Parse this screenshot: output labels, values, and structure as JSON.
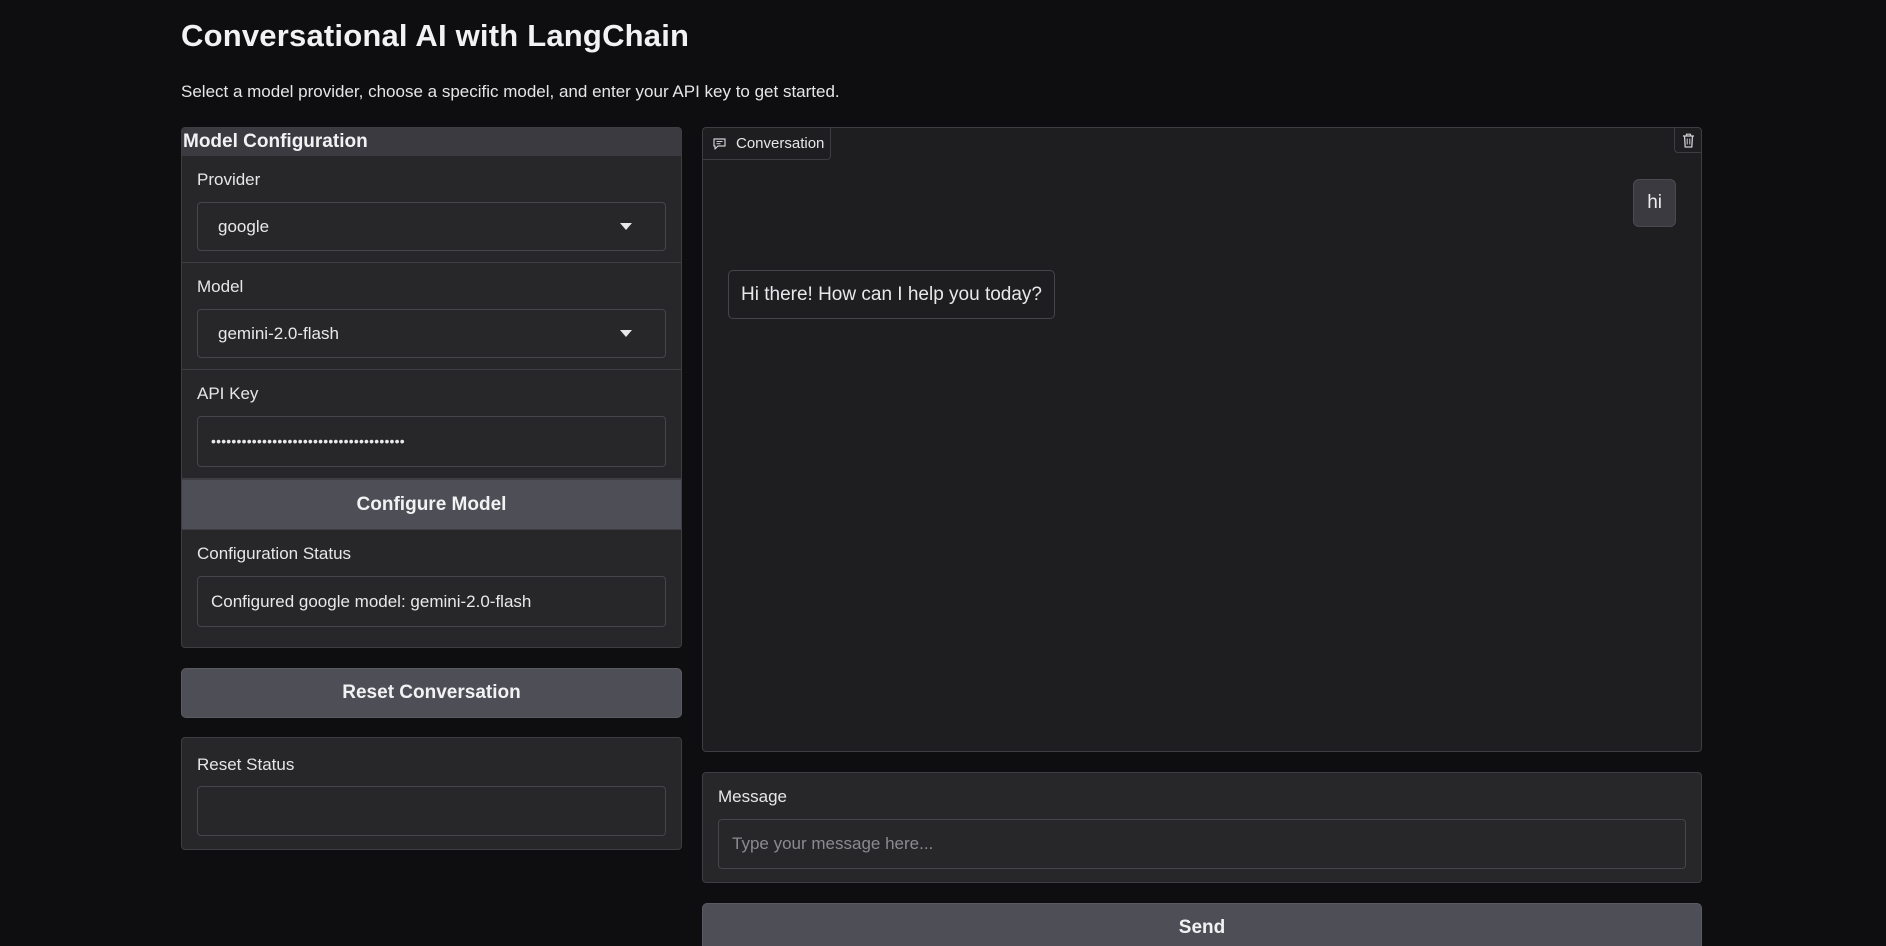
{
  "page": {
    "title": "Conversational AI with LangChain",
    "subtitle": "Select a model provider, choose a specific model, and enter your API key to get started."
  },
  "config": {
    "header": "Model Configuration",
    "provider_label": "Provider",
    "provider_value": "google",
    "model_label": "Model",
    "model_value": "gemini-2.0-flash",
    "api_key_label": "API Key",
    "api_key_masked": "••••••••••••••••••••••••••••••••••••••",
    "configure_button": "Configure Model",
    "status_label": "Configuration Status",
    "status_value": "Configured google model: gemini-2.0-flash"
  },
  "reset": {
    "button": "Reset Conversation",
    "status_label": "Reset Status",
    "status_value": ""
  },
  "chat": {
    "tab_label": "Conversation",
    "messages": [
      {
        "role": "user",
        "text": "hi"
      },
      {
        "role": "assistant",
        "text": "Hi there! How can I help you today?"
      }
    ]
  },
  "message": {
    "label": "Message",
    "placeholder": "Type your message here...",
    "value": ""
  },
  "send_button": "Send",
  "icons": {
    "chat_tab": "chat-bubble-icon",
    "clear": "trash-icon",
    "dropdown": "caret-down-icon"
  }
}
